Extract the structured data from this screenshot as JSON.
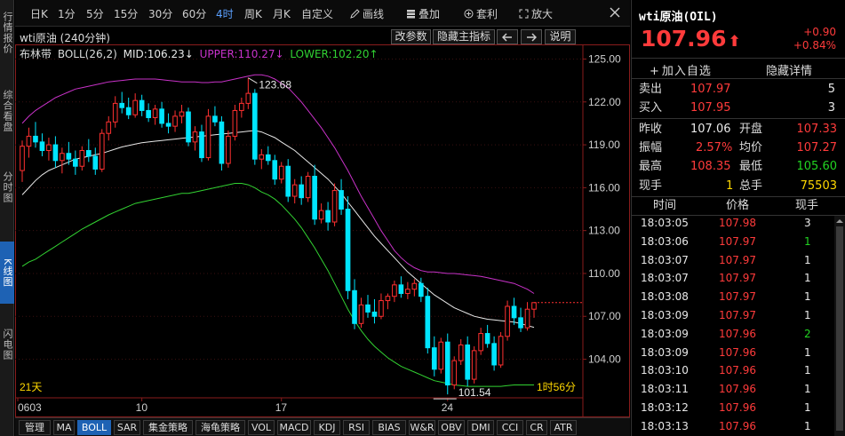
{
  "left_tabs": [
    {
      "label": "行情报价"
    },
    {
      "label": "综合看盘"
    },
    {
      "label": "分时图"
    },
    {
      "label": "K线图"
    },
    {
      "label": "闪电图"
    }
  ],
  "toolbar": {
    "periods": [
      "日K",
      "1分",
      "5分",
      "15分",
      "30分",
      "60分",
      "4时",
      "周K",
      "月K",
      "自定义"
    ],
    "active_period": "4时",
    "draw": "画线",
    "overlay": "叠加",
    "arb": "套利",
    "zoom": "放大"
  },
  "chart_title": "wti原油 (240分钟)",
  "header_buttons": {
    "params": "改参数",
    "hide": "隐藏主指标",
    "prev": "◀",
    "next": "▶",
    "help": "说明"
  },
  "boll": {
    "name": "布林带",
    "params": "BOLL(26,2)",
    "mid": "MID:106.23↓",
    "upper": "UPPER:110.27↓",
    "lower": "LOWER:102.20↑"
  },
  "colors": {
    "upper": "#c832c8",
    "mid": "#e8e8e8",
    "lower": "#32d232",
    "up": "#ff3030",
    "down": "#00e5ff"
  },
  "y_ticks": [
    "125.00",
    "122.00",
    "119.00",
    "116.00",
    "113.00",
    "110.00",
    "107.00",
    "104.00"
  ],
  "x_ticks": [
    "0603",
    "10",
    "17",
    "24"
  ],
  "annotations": {
    "high": "123.68",
    "low": "101.54",
    "days": "21天",
    "countdown": "1时56分"
  },
  "bottom_tabs": [
    "管理",
    "MA",
    "BOLL",
    "SAR",
    "集金策略",
    "海龟策略",
    "VOL",
    "MACD",
    "KDJ",
    "RSI",
    "BIAS",
    "W&R",
    "OBV",
    "DMI",
    "CCI",
    "CR",
    "ATR"
  ],
  "active_bottom_tab": "BOLL",
  "chart_data": {
    "type": "candlestick",
    "ylim": [
      101.3,
      125.9
    ],
    "candles": [
      [
        117.2,
        119.3,
        116.4,
        118.9
      ],
      [
        118.9,
        120.2,
        118.1,
        119.6
      ],
      [
        119.6,
        120.6,
        118.8,
        119.2
      ],
      [
        119.2,
        119.8,
        118.2,
        118.6
      ],
      [
        118.6,
        119.5,
        117.9,
        119.0
      ],
      [
        119.0,
        119.6,
        117.4,
        117.9
      ],
      [
        117.9,
        118.8,
        117.0,
        118.4
      ],
      [
        118.4,
        119.2,
        117.6,
        118.0
      ],
      [
        118.0,
        118.6,
        116.9,
        117.5
      ],
      [
        117.5,
        118.9,
        117.2,
        118.6
      ],
      [
        118.6,
        119.4,
        117.8,
        118.2
      ],
      [
        118.2,
        118.8,
        116.9,
        117.3
      ],
      [
        117.3,
        120.1,
        117.1,
        119.8
      ],
      [
        119.8,
        121.0,
        119.3,
        120.6
      ],
      [
        120.6,
        122.4,
        120.2,
        121.9
      ],
      [
        121.9,
        122.7,
        121.2,
        121.6
      ],
      [
        121.6,
        122.3,
        120.8,
        121.1
      ],
      [
        121.1,
        122.6,
        120.9,
        122.1
      ],
      [
        122.1,
        122.5,
        121.0,
        121.4
      ],
      [
        121.4,
        121.9,
        120.6,
        120.9
      ],
      [
        120.9,
        121.8,
        120.4,
        121.5
      ],
      [
        121.5,
        122.0,
        120.2,
        120.5
      ],
      [
        120.5,
        121.2,
        119.8,
        120.3
      ],
      [
        120.3,
        121.4,
        119.9,
        121.0
      ],
      [
        121.0,
        121.8,
        120.5,
        121.3
      ],
      [
        121.3,
        121.6,
        118.9,
        119.2
      ],
      [
        119.2,
        120.3,
        118.6,
        119.9
      ],
      [
        119.9,
        120.4,
        117.8,
        118.1
      ],
      [
        118.1,
        121.5,
        117.9,
        121.0
      ],
      [
        121.0,
        121.7,
        120.3,
        120.6
      ],
      [
        120.6,
        121.0,
        117.2,
        117.7
      ],
      [
        117.7,
        120.0,
        117.4,
        119.6
      ],
      [
        119.6,
        121.8,
        119.3,
        121.4
      ],
      [
        121.4,
        122.3,
        120.9,
        121.9
      ],
      [
        121.9,
        123.68,
        121.5,
        122.6
      ],
      [
        122.6,
        122.9,
        117.6,
        118.0
      ],
      [
        118.0,
        118.7,
        117.3,
        118.3
      ],
      [
        118.3,
        118.9,
        117.6,
        117.9
      ],
      [
        117.9,
        118.3,
        116.2,
        116.6
      ],
      [
        116.6,
        117.8,
        116.3,
        117.5
      ],
      [
        117.5,
        118.0,
        115.0,
        115.4
      ],
      [
        115.4,
        116.6,
        114.9,
        116.2
      ],
      [
        116.2,
        116.8,
        114.8,
        115.3
      ],
      [
        115.3,
        117.1,
        115.0,
        116.8
      ],
      [
        116.8,
        117.6,
        113.4,
        113.8
      ],
      [
        113.8,
        114.9,
        113.5,
        114.4
      ],
      [
        114.4,
        115.0,
        113.0,
        113.6
      ],
      [
        113.6,
        116.3,
        113.3,
        115.8
      ],
      [
        115.8,
        116.6,
        114.1,
        114.5
      ],
      [
        114.5,
        115.4,
        108.2,
        108.8
      ],
      [
        108.8,
        109.6,
        106.1,
        106.5
      ],
      [
        106.5,
        108.3,
        106.2,
        107.8
      ],
      [
        107.8,
        108.5,
        106.9,
        107.3
      ],
      [
        107.3,
        108.2,
        106.5,
        107.0
      ],
      [
        107.0,
        108.6,
        106.8,
        108.1
      ],
      [
        108.1,
        108.6,
        107.5,
        108.4
      ],
      [
        108.4,
        109.5,
        108.0,
        109.2
      ],
      [
        109.2,
        109.8,
        108.3,
        108.6
      ],
      [
        108.6,
        109.4,
        108.2,
        108.9
      ],
      [
        108.9,
        109.6,
        108.4,
        109.3
      ],
      [
        109.3,
        109.7,
        108.0,
        108.4
      ],
      [
        108.4,
        109.0,
        104.4,
        104.8
      ],
      [
        104.8,
        105.6,
        102.8,
        103.3
      ],
      [
        103.3,
        105.5,
        103.0,
        105.2
      ],
      [
        105.2,
        105.8,
        101.54,
        102.2
      ],
      [
        102.2,
        104.2,
        101.9,
        103.9
      ],
      [
        103.9,
        105.4,
        103.6,
        105.0
      ],
      [
        105.0,
        105.6,
        102.1,
        102.6
      ],
      [
        102.6,
        104.9,
        102.3,
        104.6
      ],
      [
        104.6,
        106.2,
        104.3,
        105.8
      ],
      [
        105.8,
        106.4,
        104.8,
        105.1
      ],
      [
        105.1,
        105.6,
        103.2,
        103.6
      ],
      [
        103.6,
        105.9,
        103.4,
        105.6
      ],
      [
        105.6,
        108.1,
        105.3,
        107.7
      ],
      [
        107.7,
        108.3,
        106.4,
        106.9
      ],
      [
        106.9,
        107.6,
        105.9,
        106.2
      ],
      [
        106.2,
        108.0,
        106.0,
        107.5
      ],
      [
        107.5,
        107.9,
        106.9,
        107.96
      ]
    ],
    "upper": [
      120.5,
      121.0,
      121.4,
      121.7,
      122.0,
      122.3,
      122.5,
      122.7,
      122.9,
      123.0,
      123.1,
      123.2,
      123.3,
      123.4,
      123.45,
      123.5,
      123.55,
      123.6,
      123.6,
      123.6,
      123.6,
      123.55,
      123.5,
      123.45,
      123.4,
      123.4,
      123.4,
      123.35,
      123.35,
      123.4,
      123.4,
      123.5,
      123.6,
      123.7,
      123.8,
      123.9,
      123.9,
      123.8,
      123.6,
      123.3,
      123.0,
      122.5,
      122.0,
      121.4,
      120.8,
      120.2,
      119.5,
      118.8,
      118.0,
      117.2,
      116.3,
      115.4,
      114.6,
      113.8,
      113.0,
      112.3,
      111.6,
      111.1,
      110.7,
      110.4,
      110.2,
      110.1,
      110.1,
      110.05,
      110.0,
      110.0,
      109.95,
      109.9,
      109.85,
      109.8,
      109.7,
      109.6,
      109.5,
      109.4,
      109.3,
      109.1,
      108.9,
      108.6
    ],
    "mid": [
      115.5,
      116.0,
      116.5,
      116.9,
      117.2,
      117.4,
      117.6,
      117.8,
      118.0,
      118.1,
      118.2,
      118.3,
      118.4,
      118.55,
      118.7,
      118.85,
      118.95,
      119.05,
      119.15,
      119.2,
      119.25,
      119.3,
      119.35,
      119.4,
      119.45,
      119.5,
      119.55,
      119.6,
      119.65,
      119.7,
      119.75,
      119.8,
      119.85,
      119.9,
      119.95,
      120.0,
      119.9,
      119.7,
      119.5,
      119.2,
      118.9,
      118.6,
      118.2,
      117.8,
      117.4,
      117.0,
      116.6,
      116.1,
      115.6,
      115.0,
      114.4,
      113.8,
      113.2,
      112.6,
      112.1,
      111.6,
      111.1,
      110.6,
      110.1,
      109.7,
      109.3,
      108.9,
      108.5,
      108.2,
      107.9,
      107.6,
      107.4,
      107.2,
      107.0,
      106.9,
      106.8,
      106.75,
      106.7,
      106.65,
      106.6,
      106.5,
      106.35,
      106.23
    ],
    "lower": [
      110.5,
      110.8,
      111.0,
      111.3,
      111.6,
      111.9,
      112.2,
      112.5,
      112.8,
      113.1,
      113.35,
      113.6,
      113.85,
      114.1,
      114.3,
      114.5,
      114.7,
      114.9,
      115.0,
      115.1,
      115.2,
      115.3,
      115.4,
      115.5,
      115.6,
      115.6,
      115.7,
      115.8,
      115.9,
      116.0,
      116.1,
      116.2,
      116.3,
      116.3,
      116.2,
      116.0,
      115.7,
      115.5,
      115.2,
      114.8,
      114.3,
      113.8,
      113.2,
      112.5,
      111.8,
      111.0,
      110.2,
      109.3,
      108.4,
      107.5,
      106.7,
      106.0,
      105.4,
      104.9,
      104.5,
      104.1,
      103.8,
      103.5,
      103.3,
      103.1,
      102.9,
      102.7,
      102.5,
      102.4,
      102.3,
      102.2,
      102.15,
      102.1,
      102.1,
      102.1,
      102.1,
      102.1,
      102.1,
      102.15,
      102.2,
      102.2,
      102.2,
      102.2
    ]
  },
  "quote": {
    "title": "wti原油(OIL)",
    "price": "107.96",
    "arrow": "⬆",
    "change": "+0.90",
    "change_pct": "+0.84%",
    "add_watch": "加入自选",
    "hide_detail": "隐藏详情",
    "sell_label": "卖出",
    "sell_price": "107.97",
    "sell_vol": "5",
    "buy_label": "买入",
    "buy_price": "107.95",
    "buy_vol": "3",
    "prev_close_label": "昨收",
    "prev_close": "107.06",
    "open_label": "开盘",
    "open": "107.33",
    "amp_label": "振幅",
    "amp": "2.57%",
    "avg_label": "均价",
    "avg": "107.27",
    "high_label": "最高",
    "high": "108.35",
    "low_label": "最低",
    "low": "105.60",
    "cur_vol_label": "现手",
    "cur_vol": "1",
    "total_vol_label": "总手",
    "total_vol": "75503",
    "col_time": "时间",
    "col_price": "价格",
    "col_vol": "现手"
  },
  "ticks": [
    {
      "time": "18:03:05",
      "price": "107.98",
      "vol": "3",
      "c": "wht"
    },
    {
      "time": "18:03:06",
      "price": "107.97",
      "vol": "1",
      "c": "green"
    },
    {
      "time": "18:03:07",
      "price": "107.97",
      "vol": "1",
      "c": "wht"
    },
    {
      "time": "18:03:07",
      "price": "107.97",
      "vol": "1",
      "c": "wht"
    },
    {
      "time": "18:03:08",
      "price": "107.97",
      "vol": "1",
      "c": "wht"
    },
    {
      "time": "18:03:09",
      "price": "107.97",
      "vol": "1",
      "c": "wht"
    },
    {
      "time": "18:03:09",
      "price": "107.96",
      "vol": "2",
      "c": "green"
    },
    {
      "time": "18:03:09",
      "price": "107.96",
      "vol": "1",
      "c": "wht"
    },
    {
      "time": "18:03:10",
      "price": "107.96",
      "vol": "1",
      "c": "wht"
    },
    {
      "time": "18:03:11",
      "price": "107.96",
      "vol": "1",
      "c": "wht"
    },
    {
      "time": "18:03:12",
      "price": "107.96",
      "vol": "1",
      "c": "wht"
    },
    {
      "time": "18:03:13",
      "price": "107.96",
      "vol": "1",
      "c": "wht"
    }
  ]
}
